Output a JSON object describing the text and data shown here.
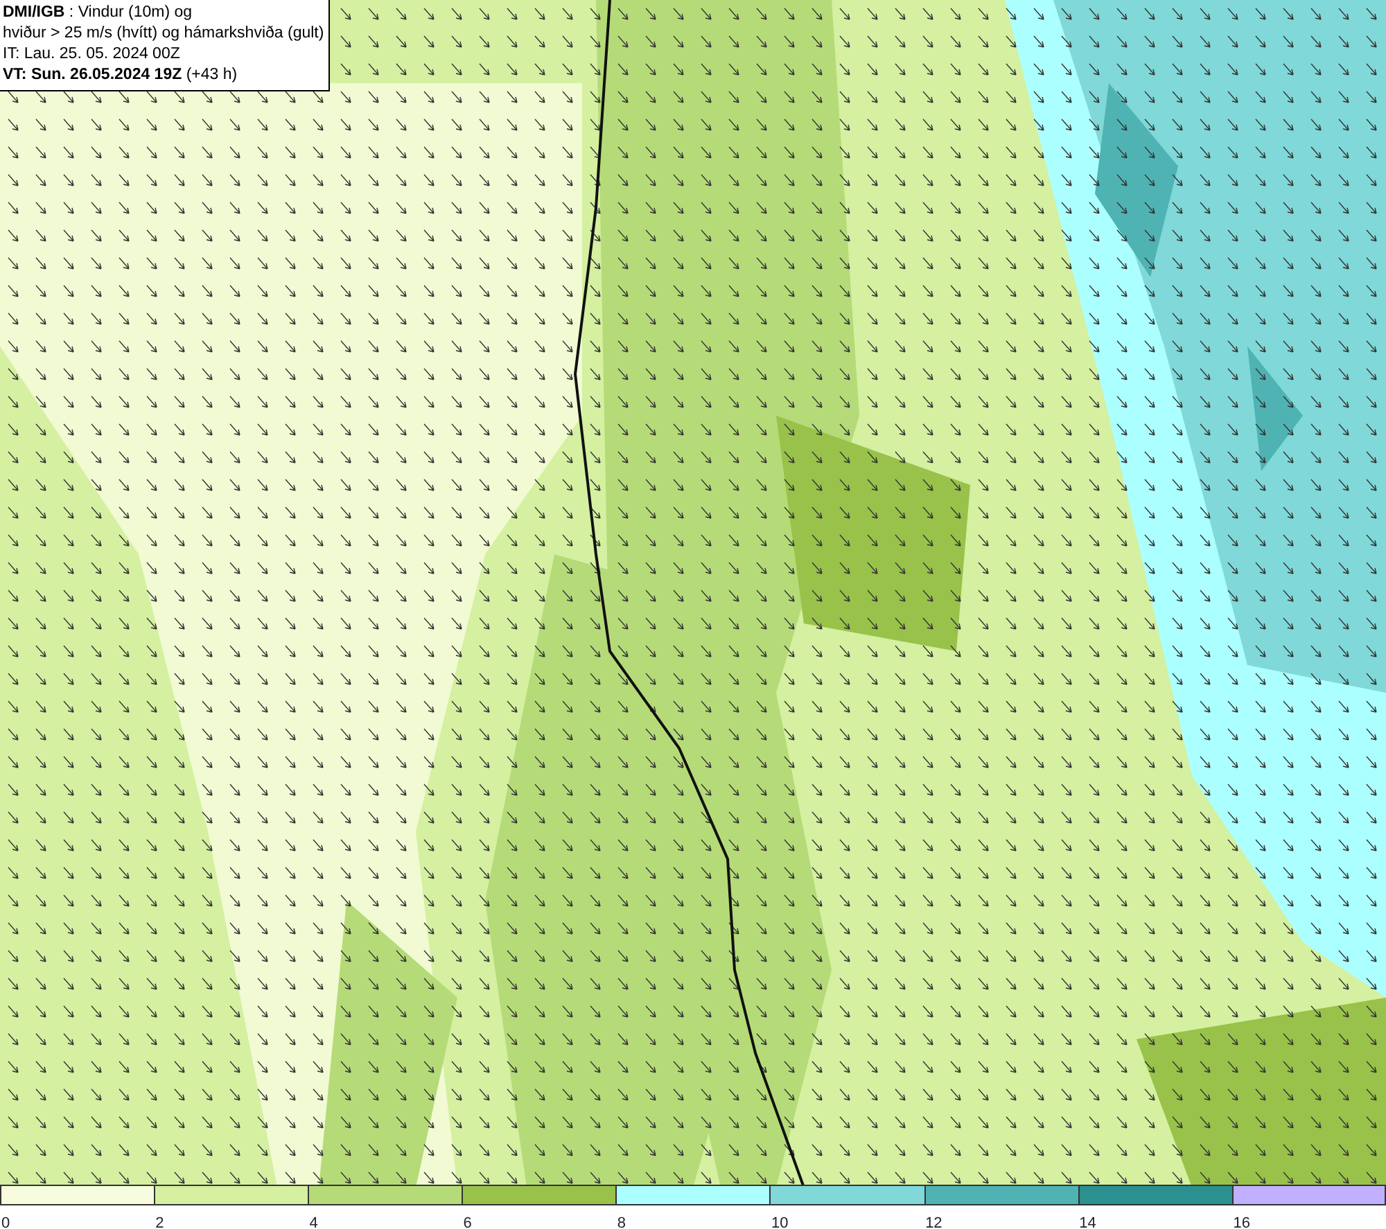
{
  "header": {
    "lines": [
      "**DMI/IGB** : Vindur (10m) og",
      "hviður > 25 m/s (hvítt) og hámarkshviða (gult)",
      "IT: Lau. 25. 05. 2024 00Z",
      "**VT: Sun. 26.05.2024 19Z** (+43 h)"
    ]
  },
  "legend": [
    {
      "label": "0",
      "color": "#f7fcde"
    },
    {
      "label": "2",
      "color": "#d4f0a0"
    },
    {
      "label": "4",
      "color": "#b5db78"
    },
    {
      "label": "6",
      "color": "#98c24a"
    },
    {
      "label": "8",
      "color": "#acffff"
    },
    {
      "label": "10",
      "color": "#80d8d8"
    },
    {
      "label": "12",
      "color": "#50b3b3"
    },
    {
      "label": "14",
      "color": "#2a9090"
    },
    {
      "label": "16",
      "color": "#c0b0ff"
    }
  ]
}
